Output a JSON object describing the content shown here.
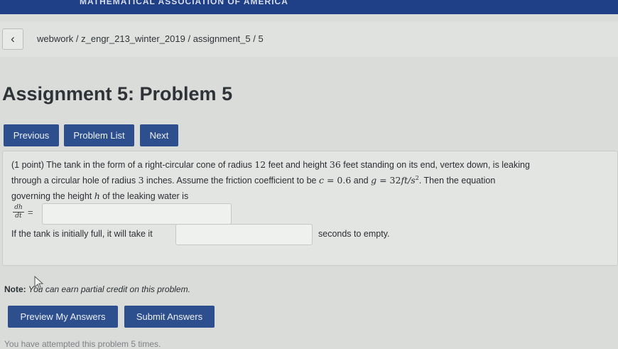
{
  "header": {
    "org_name": "MATHEMATICAL ASSOCIATION OF AMERICA"
  },
  "breadcrumb": {
    "back_icon": "chevron-left-icon",
    "text": "webwork / z_engr_213_winter_2019 / assignment_5 / 5"
  },
  "page": {
    "title": "Assignment 5: Problem 5"
  },
  "nav": {
    "previous_label": "Previous",
    "problem_list_label": "Problem List",
    "next_label": "Next"
  },
  "problem": {
    "points": "(1 point)",
    "line1_a": "The tank in the form of a right-circular cone of radius ",
    "radius": "12",
    "line1_b": " feet and height ",
    "height": "36",
    "line1_c": " feet standing on its end, vertex down, is leaking",
    "line2_a": "through a circular hole of radius ",
    "hole_radius": "3",
    "line2_b": " inches. Assume the friction coefficient to be ",
    "c_var": "c",
    "equals": " = ",
    "c_value": "0.6",
    "line2_and": " and ",
    "g_var": "g",
    "g_value": "32",
    "g_units": "ft/s",
    "g_exp": "2",
    "line2_c": ". Then the equation",
    "line3_a": "governing the height ",
    "h_var": "h",
    "line3_b": " of the leaking water is",
    "frac_num": "dh",
    "frac_den": "dt",
    "eq_sign": "=",
    "answer1_value": "",
    "line5_a": "If the tank is initially full, it will take it",
    "answer2_value": "",
    "line5_b": "seconds to empty."
  },
  "note": {
    "label": "Note:",
    "text": " You can earn partial credit on this problem."
  },
  "actions": {
    "preview_label": "Preview My Answers",
    "submit_label": "Submit Answers"
  },
  "footer": {
    "attempts_text": "You have attempted this problem 5 times."
  },
  "colors": {
    "header_bg": "#1f3f86",
    "button_bg": "#2d4f8e",
    "page_bg": "#d9dcd9"
  }
}
